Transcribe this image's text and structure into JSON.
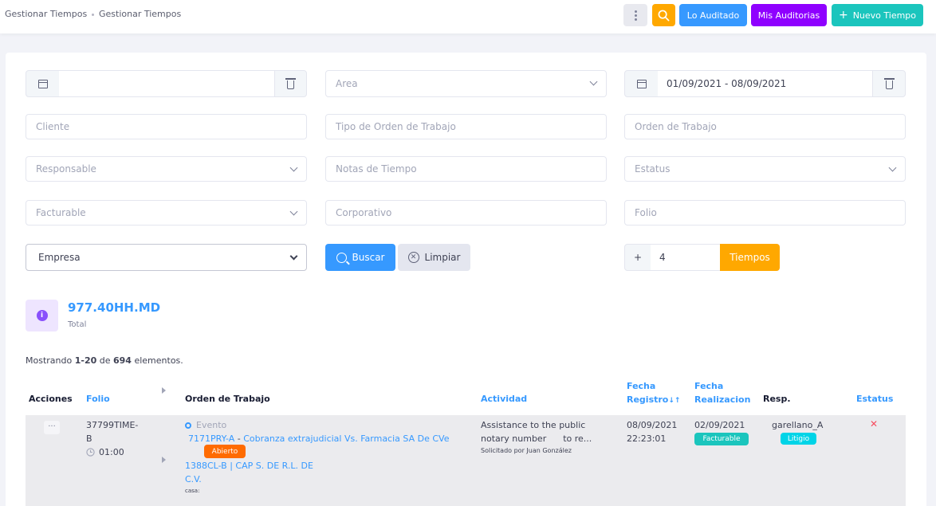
{
  "breadcrumb": {
    "item1": "Gestionar Tiempos",
    "item2": "Gestionar Tiempos"
  },
  "toolbar": {
    "lo_auditado": "Lo Auditado",
    "mis_auditorias": "Mis Auditorias",
    "nuevo_tiempo": "Nuevo Tiempo",
    "nuevo_tiempo_icon": "+"
  },
  "filters": {
    "date1_value": "",
    "area_placeholder": "Area",
    "date_range_value": "01/09/2021 - 08/09/2021",
    "cliente_placeholder": "Cliente",
    "tipo_orden_placeholder": "Tipo de Orden de Trabajo",
    "orden_placeholder": "Orden de Trabajo",
    "responsable_placeholder": "Responsable",
    "notas_placeholder": "Notas de Tiempo",
    "estatus_placeholder": "Estatus",
    "facturable_placeholder": "Facturable",
    "corporativo_placeholder": "Corporativo",
    "folio_placeholder": "Folio",
    "empresa_selected": "Empresa",
    "buscar_label": "Buscar",
    "limpiar_label": "Limpiar",
    "plus_label": "+",
    "count_value": "4",
    "tiempos_label": "Tiempos"
  },
  "summary": {
    "total_value": "977.40HH.MD",
    "total_label": "Total",
    "info_icon": "i"
  },
  "pagination": {
    "prefix": "Mostrando ",
    "range": "1-20",
    "middle": " de ",
    "total": "694",
    "suffix": " elementos."
  },
  "table": {
    "headers": {
      "acciones": "Acciones",
      "folio": "Folio",
      "orden": "Orden de Trabajo",
      "actividad": "Actividad",
      "fecha_registro_1": "Fecha",
      "fecha_registro_2": "Registro",
      "sort_icon": "↓↑",
      "fecha_realizacion_1": "Fecha",
      "fecha_realizacion_2": "Realizacion",
      "resp": "Resp.",
      "estatus": "Estatus"
    },
    "row": {
      "actions_icon": "···",
      "folio_line1": "37799TIME-",
      "folio_line2": "B",
      "time": "01:00",
      "event_label": "Evento",
      "orden_link": "7171PRY-A",
      "orden_sep": " - ",
      "orden_desc": "Cobranza extrajudicial Vs. Farmacia  SA De CVe",
      "estado_badge": "Abierto",
      "orden_line2": "1388CL-B | CAP   S. DE R.L. DE",
      "orden_line3": "C.V.",
      "casa": "casa:",
      "actividad_line1": "Assistance to the public",
      "actividad_line2": "notary number      to re...",
      "solicitado": "Solicitado por Juan González",
      "fecha_registro_line1": "08/09/2021",
      "fecha_registro_line2": "22:23:01",
      "fecha_realizacion": "02/09/2021",
      "facturable_badge": "Facturable",
      "resp": "garellano_A",
      "litigio_badge": "Litigio",
      "status_icon": "✕"
    }
  },
  "colors": {
    "primary": "#3699ff",
    "warning": "#ffa800",
    "purple": "#8f00ff",
    "success": "#1bc5bd",
    "danger": "#f64e60",
    "orange_badge": "#ff6b00",
    "cyan_badge": "#00d4e7"
  }
}
